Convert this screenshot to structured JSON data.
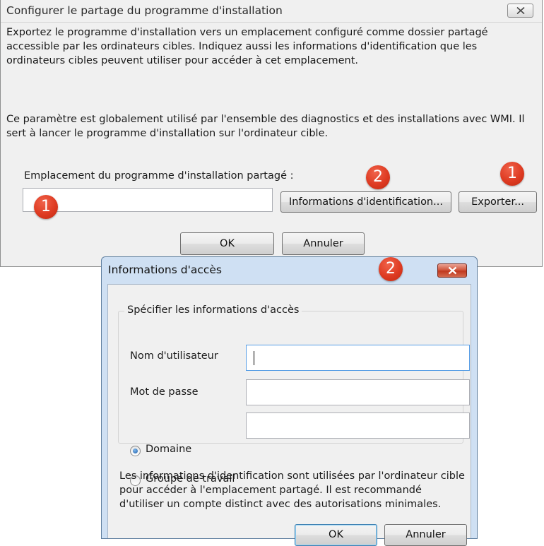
{
  "main_dialog": {
    "title": "Configurer le partage du programme d'installation",
    "paragraph1": "Exportez le programme d'installation vers un emplacement configuré comme dossier partagé accessible par les ordinateurs cibles. Indiquez aussi les informations d'identification que les ordinateurs cibles peuvent utiliser pour accéder à cet emplacement.",
    "paragraph2": "Ce paramètre est globalement utilisé par l'ensemble des diagnostics et des installations avec WMI. Il sert à lancer le programme d'installation sur l'ordinateur cible.",
    "location_label": "Emplacement du programme d'installation partagé :",
    "location_value": "",
    "credentials_button": "Informations d'identification...",
    "export_button": "Exporter...",
    "ok_button": "OK",
    "cancel_button": "Annuler"
  },
  "badges": {
    "credentials": "2",
    "export": "1",
    "location": "1",
    "access_dialog": "2"
  },
  "access_dialog": {
    "title": "Informations d'accès",
    "group_label": "Spécifier les informations d'accès",
    "username_label": "Nom d'utilisateur",
    "username_value": "",
    "password_label": "Mot de passe",
    "password_value": "",
    "domain_label": "Domaine",
    "domain_value": "",
    "domain_selected": true,
    "workgroup_label": "Groupe de travail",
    "workgroup_selected": false,
    "note": "Les informations d'identification sont utilisées par l'ordinateur cible pour accéder à l'emplacement partagé. Il est recommandé d'utiliser un compte distinct avec des autorisations minimales.",
    "ok_button": "OK",
    "cancel_button": "Annuler"
  },
  "colors": {
    "badge": "#de3b22",
    "dialog_background": "#f0f0f0",
    "aero_frame": "#cfe0f3",
    "close_button_red": "#c0391f"
  },
  "icons": {
    "main_close": "close-icon",
    "access_close": "close-icon"
  }
}
